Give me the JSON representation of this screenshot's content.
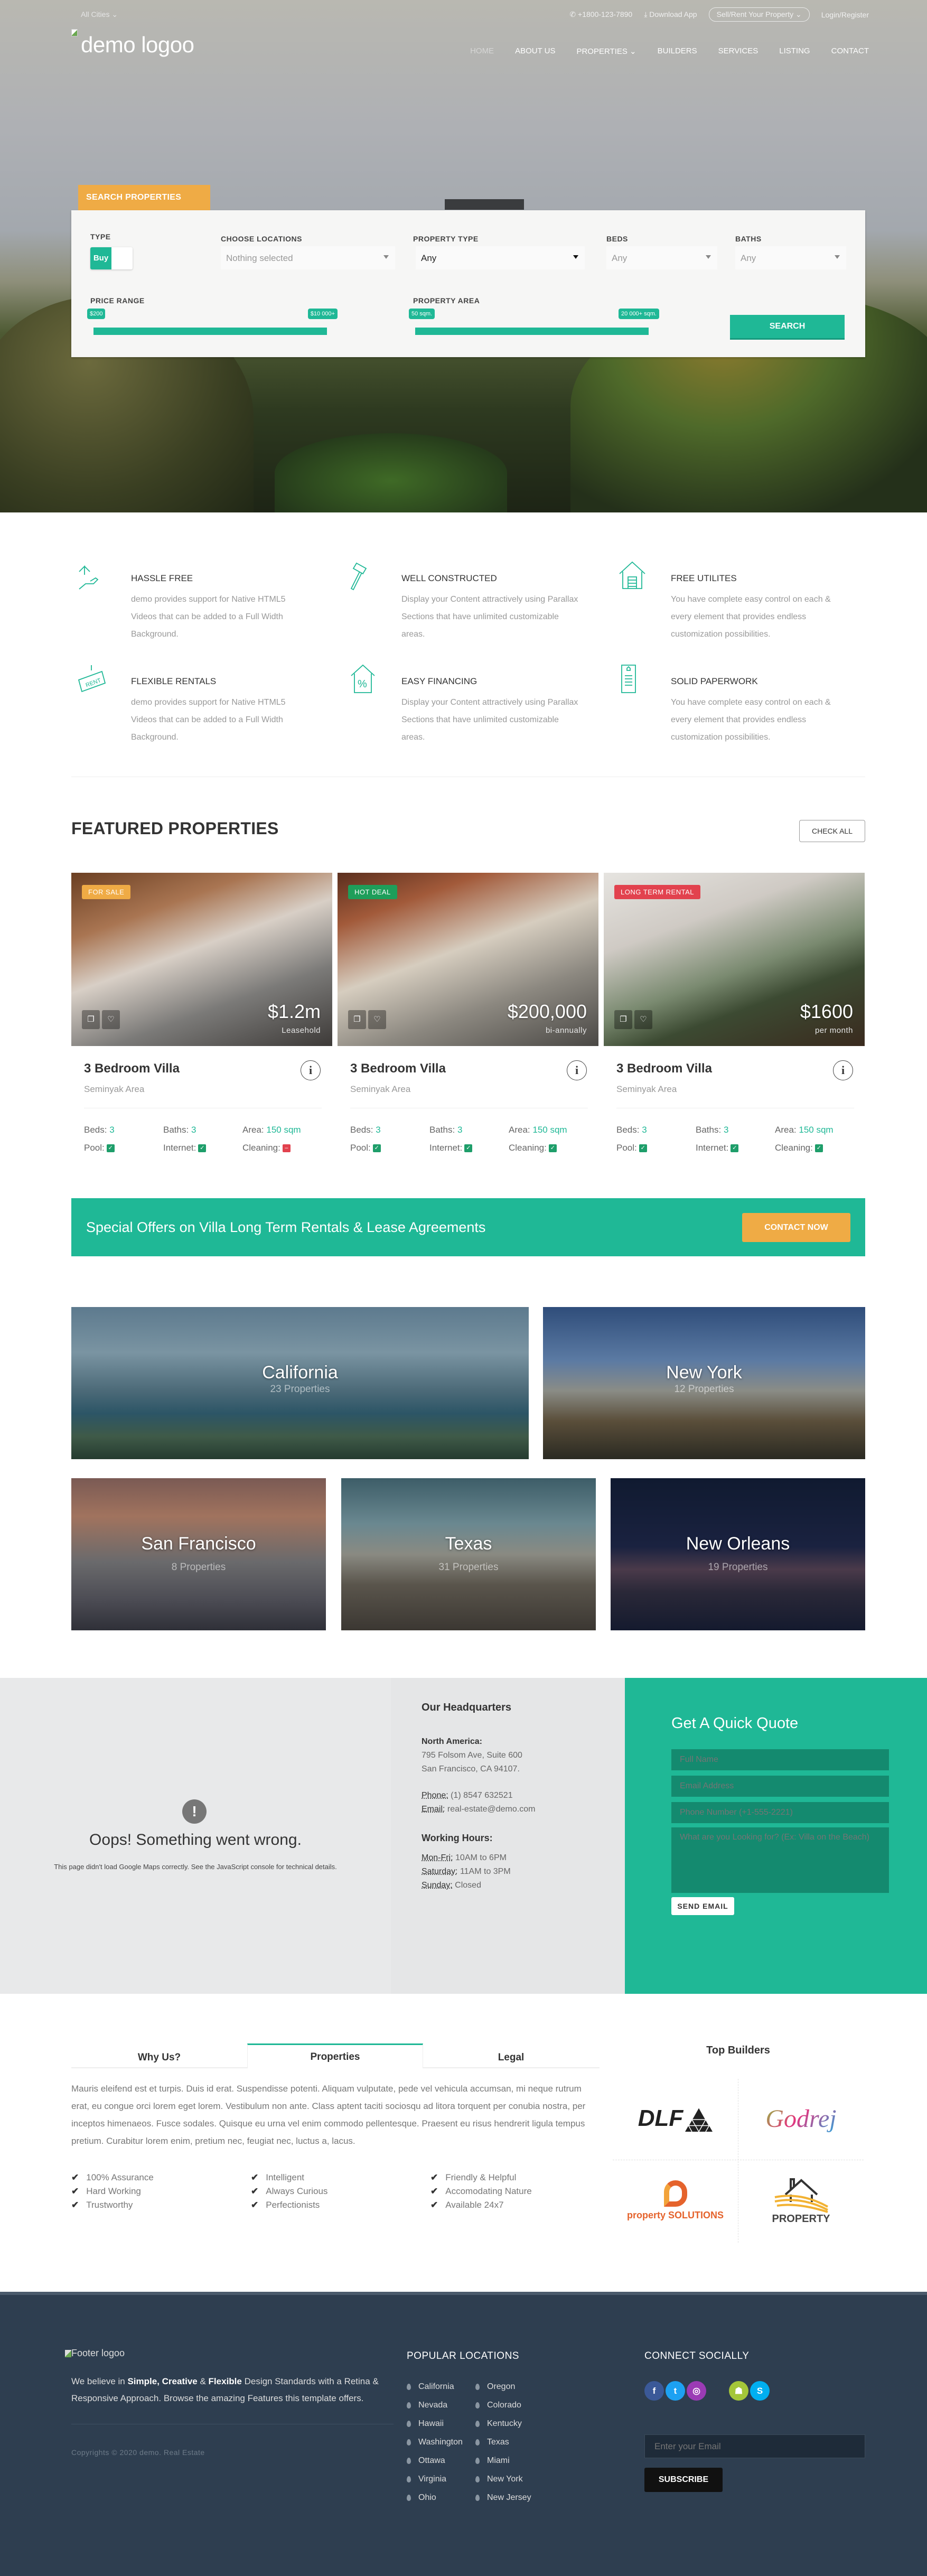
{
  "topbar": {
    "cities": "All Cities ⌄",
    "phone": "+1800-123-7890",
    "download": "Download App",
    "sell": "Sell/Rent Your Property ⌄",
    "login": "Login/Register"
  },
  "logo": "demo logoo",
  "nav": [
    "HOME",
    "ABOUT US",
    "PROPERTIES ⌄",
    "BUILDERS",
    "SERVICES",
    "LISTING",
    "CONTACT"
  ],
  "search": {
    "tab": "SEARCH PROPERTIES",
    "type_label": "TYPE",
    "type_value": "Buy",
    "locations_label": "CHOOSE LOCATIONS",
    "locations_value": "Nothing selected",
    "ptype_label": "PROPERTY TYPE",
    "ptype_value": "Any",
    "beds_label": "BEDS",
    "beds_value": "Any",
    "baths_label": "BATHS",
    "baths_value": "Any",
    "price_label": "PRICE RANGE",
    "price_min": "$200",
    "price_max": "$10 000+",
    "area_label": "PROPERTY AREA",
    "area_min": "50 sqm.",
    "area_max": "20 000+ sqm.",
    "button": "SEARCH"
  },
  "features": [
    {
      "icon": "hand-house-icon",
      "title": "HASSLE FREE",
      "text": "demo provides support for Native HTML5 Videos that can be added to a Full Width Background."
    },
    {
      "icon": "hammer-icon",
      "title": "WELL CONSTRUCTED",
      "text": "Display your Content attractively using Parallax Sections that have unlimited customizable areas."
    },
    {
      "icon": "house-garage-icon",
      "title": "FREE UTILITES",
      "text": "You have complete easy control on each & every element that provides endless customization possibilities."
    },
    {
      "icon": "rent-sign-icon",
      "title": "FLEXIBLE RENTALS",
      "text": "demo provides support for Native HTML5 Videos that can be added to a Full Width Background."
    },
    {
      "icon": "house-percent-icon",
      "title": "EASY FINANCING",
      "text": "Display your Content attractively using Parallax Sections that have unlimited customizable areas."
    },
    {
      "icon": "document-icon",
      "title": "SOLID PAPERWORK",
      "text": "You have complete easy control on each & every element that provides endless customization possibilities."
    }
  ],
  "featured": {
    "title": "FEATURED PROPERTIES",
    "check_all": "CHECK ALL",
    "cards": [
      {
        "badge": "FOR SALE",
        "badge_color": "#efab45",
        "price": "$1.2m",
        "period": "Leasehold",
        "name": "3 Bedroom Villa",
        "area": "Seminyak Area",
        "beds_label": "Beds:",
        "beds": "3",
        "baths_label": "Baths:",
        "baths": "3",
        "size_label": "Area:",
        "size": "150 sqm",
        "pool_label": "Pool:",
        "pool": true,
        "internet_label": "Internet:",
        "internet": true,
        "cleaning_label": "Cleaning:",
        "cleaning": false
      },
      {
        "badge": "HOT DEAL",
        "badge_color": "#1e9e5a",
        "price": "$200,000",
        "period": "bi-annually",
        "name": "3 Bedroom Villa",
        "area": "Seminyak Area",
        "beds_label": "Beds:",
        "beds": "3",
        "baths_label": "Baths:",
        "baths": "3",
        "size_label": "Area:",
        "size": "150 sqm",
        "pool_label": "Pool:",
        "pool": true,
        "internet_label": "Internet:",
        "internet": true,
        "cleaning_label": "Cleaning:",
        "cleaning": true
      },
      {
        "badge": "LONG TERM RENTAL",
        "badge_color": "#e2424e",
        "price": "$1600",
        "period": "per month",
        "name": "3 Bedroom Villa",
        "area": "Seminyak Area",
        "beds_label": "Beds:",
        "beds": "3",
        "baths_label": "Baths:",
        "baths": "3",
        "size_label": "Area:",
        "size": "150 sqm",
        "pool_label": "Pool:",
        "pool": true,
        "internet_label": "Internet:",
        "internet": true,
        "cleaning_label": "Cleaning:",
        "cleaning": true
      }
    ]
  },
  "offer": {
    "text": "Special Offers on Villa Long Term Rentals & Lease Agreements",
    "button": "CONTACT NOW"
  },
  "cities": [
    {
      "name": "California",
      "count": "23 Properties"
    },
    {
      "name": "New York",
      "count": "12 Properties"
    },
    {
      "name": "San Francisco",
      "count": "8 Properties"
    },
    {
      "name": "Texas",
      "count": "31 Properties"
    },
    {
      "name": "New Orleans",
      "count": "19 Properties"
    }
  ],
  "map": {
    "title": "Oops! Something went wrong.",
    "text": "This page didn't load Google Maps correctly. See the JavaScript console for technical details."
  },
  "hq": {
    "title": "Our Headquarters",
    "region": "North America:",
    "address1": "795 Folsom Ave, Suite 600",
    "address2": "San Francisco, CA 94107.",
    "phone_label": "Phone:",
    "phone": "(1) 8547 632521",
    "email_label": "Email:",
    "email": "real-estate@demo.com",
    "hours_title": "Working Hours:",
    "monfri_label": "Mon-Fri:",
    "monfri": "10AM to 6PM",
    "sat_label": "Saturday:",
    "sat": "11AM to 3PM",
    "sun_label": "Sunday:",
    "sun": "Closed"
  },
  "quote": {
    "title": "Get A Quick Quote",
    "name_ph": "Full Name",
    "email_ph": "Email Address",
    "phone_ph": "Phone Number (+1-555-2221)",
    "msg_ph": "What are you Looking for? (Ex: Villa on the Beach)",
    "button": "SEND EMAIL"
  },
  "tabs": {
    "items": [
      "Why Us?",
      "Properties",
      "Legal"
    ],
    "active": "Properties",
    "text": "Mauris eleifend est et turpis. Duis id erat. Suspendisse potenti. Aliquam vulputate, pede vel vehicula accumsan, mi neque rutrum erat, eu congue orci lorem eget lorem. Vestibulum non ante. Class aptent taciti sociosqu ad litora torquent per conubia nostra, per inceptos himenaeos. Fusce sodales. Quisque eu urna vel enim commodo pellentesque. Praesent eu risus hendrerit ligula tempus pretium. Curabitur lorem enim, pretium nec, feugiat nec, luctus a, lacus.",
    "checks": [
      "100% Assurance",
      "Intelligent",
      "Friendly & Helpful",
      "Hard Working",
      "Always Curious",
      "Accomodating Nature",
      "Trustworthy",
      "Perfectionists",
      "Available 24x7"
    ]
  },
  "builders": {
    "title": "Top Builders",
    "logos": [
      "DLF",
      "Godrej",
      "property SOLUTIONS",
      "PROPERTY"
    ]
  },
  "footer": {
    "logo_alt": "Footer logoo",
    "desc_1": "We believe in ",
    "desc_b1": "Simple, Creative",
    "desc_2": " & ",
    "desc_b2": "Flexible",
    "desc_3": " Design Standards with a Retina & Responsive Approach. Browse the amazing Features this template offers.",
    "copyright": "Copyrights © 2020 demo. Real Estate",
    "locations_title": "POPULAR LOCATIONS",
    "locations": [
      "California",
      "Oregon",
      "Nevada",
      "Colorado",
      "Hawaii",
      "Kentucky",
      "Washington",
      "Texas",
      "Ottawa",
      "Miami",
      "Virginia",
      "New York",
      "Ohio",
      "New Jersey"
    ],
    "social_title": "CONNECT SOCIALLY",
    "social": [
      {
        "name": "facebook",
        "glyph": "f",
        "color": "#3b5998"
      },
      {
        "name": "twitter",
        "glyph": "t",
        "color": "#1da1f2"
      },
      {
        "name": "instagram",
        "glyph": "◎",
        "color": "#9b3bb5"
      },
      {
        "name": "apple",
        "glyph": "",
        "color": "transparent"
      },
      {
        "name": "android",
        "glyph": "☗",
        "color": "#a4c639"
      },
      {
        "name": "skype",
        "glyph": "S",
        "color": "#00aff0"
      }
    ],
    "email_ph": "Enter your Email",
    "subscribe": "SUBSCRIBE"
  },
  "colors": {
    "accent": "#1fb896",
    "orange": "#efab45",
    "footer": "#2e3e50"
  }
}
